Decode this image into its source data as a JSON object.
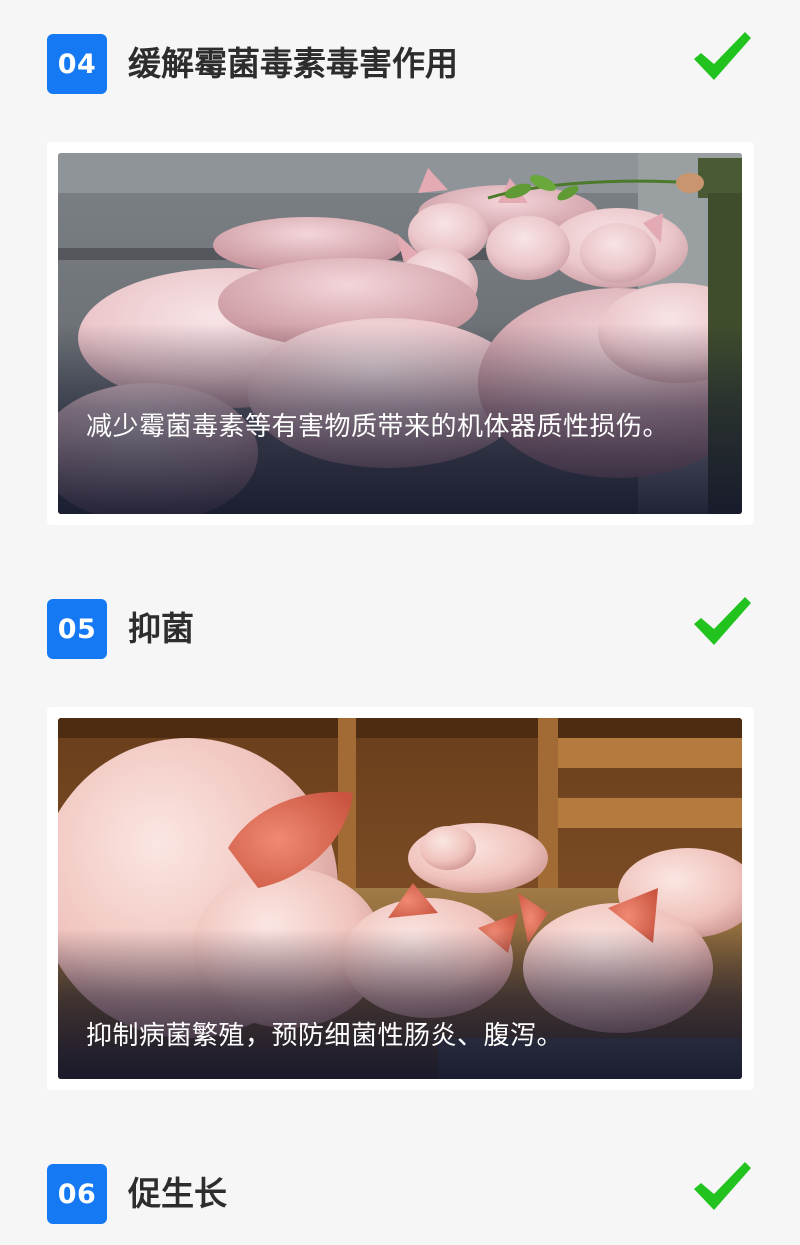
{
  "sections": [
    {
      "number": "04",
      "title": "缓解霉菌毒素毒害作用",
      "caption": "减少霉菌毒素等有害物质带来的机体器质性损伤。",
      "icon": "check-icon",
      "photo": "pigs-feeding-on-branch"
    },
    {
      "number": "05",
      "title": "抑菌",
      "caption": "抑制病菌繁殖，预防细菌性肠炎、腹泻。",
      "icon": "check-icon",
      "photo": "pigs-in-barn-on-straw"
    },
    {
      "number": "06",
      "title": "促生长",
      "icon": "check-icon"
    }
  ],
  "colors": {
    "badge": "#1479f3",
    "check": "#22c21f",
    "title": "#2d2d2d",
    "background": "#f6f6f6"
  }
}
